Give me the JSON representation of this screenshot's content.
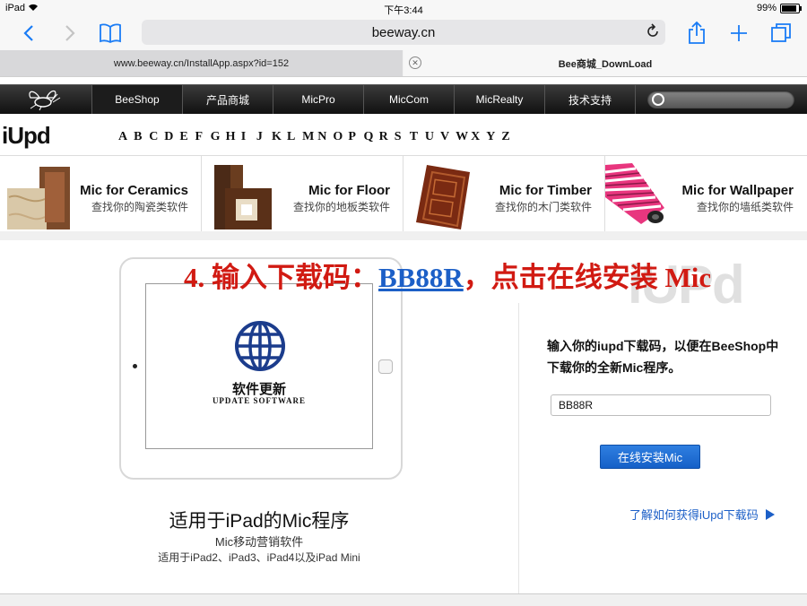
{
  "status_bar": {
    "device": "iPad",
    "time": "下午3:44",
    "battery": "99%"
  },
  "browser": {
    "url": "beeway.cn",
    "tabs": [
      {
        "label": "www.beeway.cn/InstallApp.aspx?id=152",
        "active": false
      },
      {
        "label": "Bee商城_DownLoad",
        "active": true
      }
    ]
  },
  "site_nav": {
    "items": [
      "BeeShop",
      "产品商城",
      "MicPro",
      "MicCom",
      "MicRealty",
      "技术支持"
    ],
    "active": "BeeShop"
  },
  "brand": "iUpd",
  "alphabet": [
    "A",
    "B",
    "C",
    "D",
    "E",
    "F",
    "G",
    "H",
    "I",
    "J",
    "K",
    "L",
    "M",
    "N",
    "O",
    "P",
    "Q",
    "R",
    "S",
    "T",
    "U",
    "V",
    "W",
    "X",
    "Y",
    "Z"
  ],
  "categories": [
    {
      "title": "Mic for Ceramics",
      "subtitle": "查找你的陶瓷类软件"
    },
    {
      "title": "Mic for Floor",
      "subtitle": "查找你的地板类软件"
    },
    {
      "title": "Mic for Timber",
      "subtitle": "查找你的木门类软件"
    },
    {
      "title": "Mic for Wallpaper",
      "subtitle": "查找你的墙纸类软件"
    }
  ],
  "instruction": {
    "prefix": "4. 输入下载码：",
    "code": "BB88R",
    "suffix": "，点击在线安装 Mic"
  },
  "watermark": "iUPd",
  "ipad_screen": {
    "title": "软件更新",
    "subtitle": "UPDATE SOFTWARE"
  },
  "app_info": {
    "title": "适用于iPad的Mic程序",
    "line1": "Mic移动营销软件",
    "line2": "适用于iPad2、iPad3、iPad4以及iPad Mini"
  },
  "download_panel": {
    "prompt": "输入你的iupd下载码，以便在BeeShop中下载你的全新Mic程序。",
    "code_value": "BB88R",
    "install_button": "在线安装Mic",
    "help_link": "了解如何获得iUpd下载码"
  },
  "colors": {
    "accent_blue": "#1a7cf5",
    "instruction_red": "#d11a12",
    "button_blue": "#1560c8"
  }
}
